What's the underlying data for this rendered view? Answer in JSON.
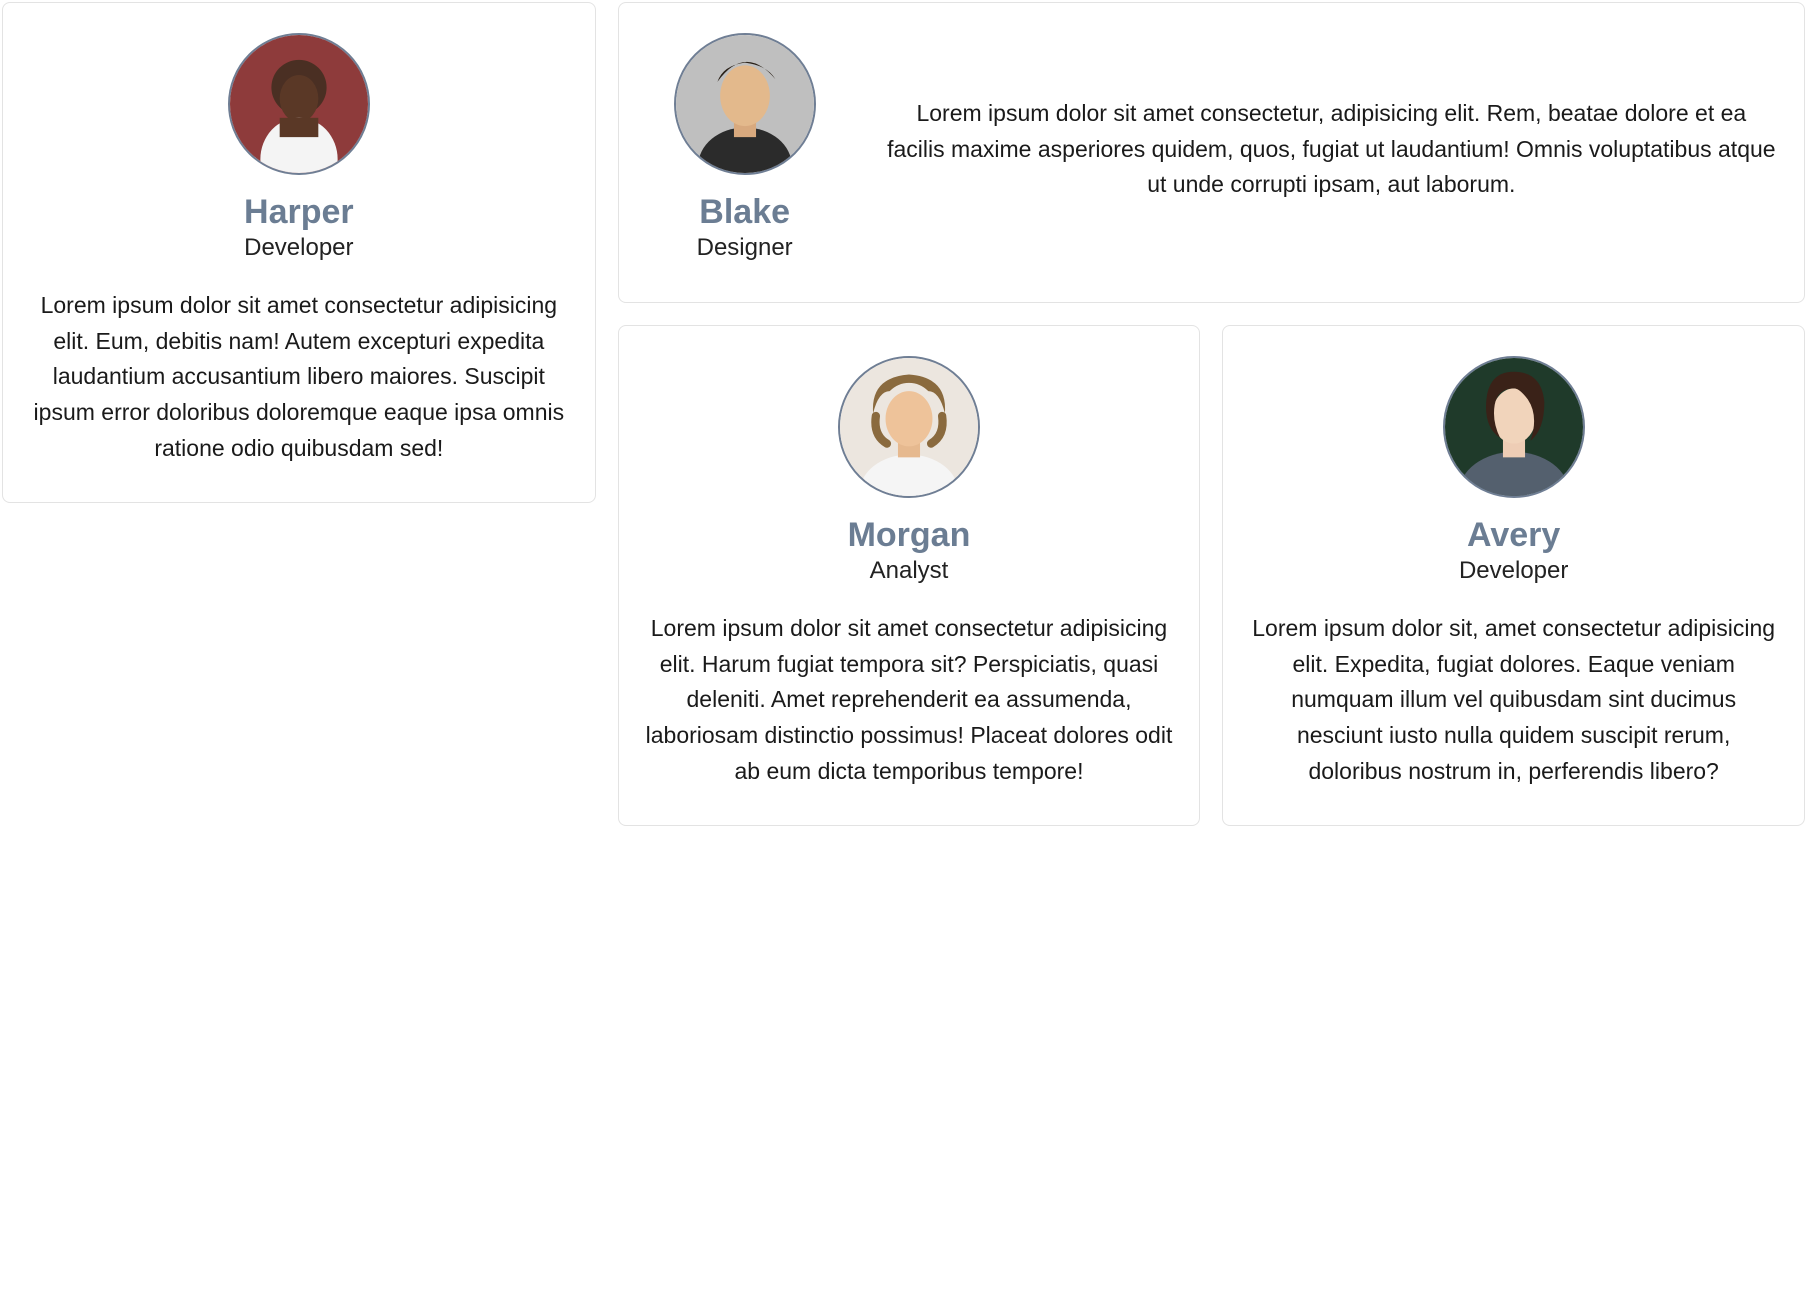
{
  "cards": [
    {
      "name": "Harper",
      "role": "Developer",
      "desc": "Lorem ipsum dolor sit amet consectetur adipisicing elit. Eum, debitis nam! Autem excepturi expedita laudantium accusantium libero maiores. Suscipit ipsum error doloribus doloremque eaque ipsa omnis ratione odio quibusdam sed!"
    },
    {
      "name": "Blake",
      "role": "Designer",
      "desc": "Lorem ipsum dolor sit amet consectetur, adipisicing elit. Rem, beatae dolore et ea facilis maxime asperiores quidem, quos, fugiat ut laudantium! Omnis voluptatibus atque ut unde corrupti ipsam, aut laborum."
    },
    {
      "name": "Morgan",
      "role": "Analyst",
      "desc": "Lorem ipsum dolor sit amet consectetur adipisicing elit. Harum fugiat tempora sit? Perspiciatis, quasi deleniti. Amet reprehenderit ea assumenda, laboriosam distinctio possimus! Placeat dolores odit ab eum dicta temporibus tempore!"
    },
    {
      "name": "Avery",
      "role": "Developer",
      "desc": "Lorem ipsum dolor sit, amet consectetur adipisicing elit. Expedita, fugiat dolores. Eaque veniam numquam illum vel quibusdam sint ducimus nesciunt iusto nulla quidem suscipit rerum, doloribus nostrum in, perferendis libero?"
    }
  ]
}
